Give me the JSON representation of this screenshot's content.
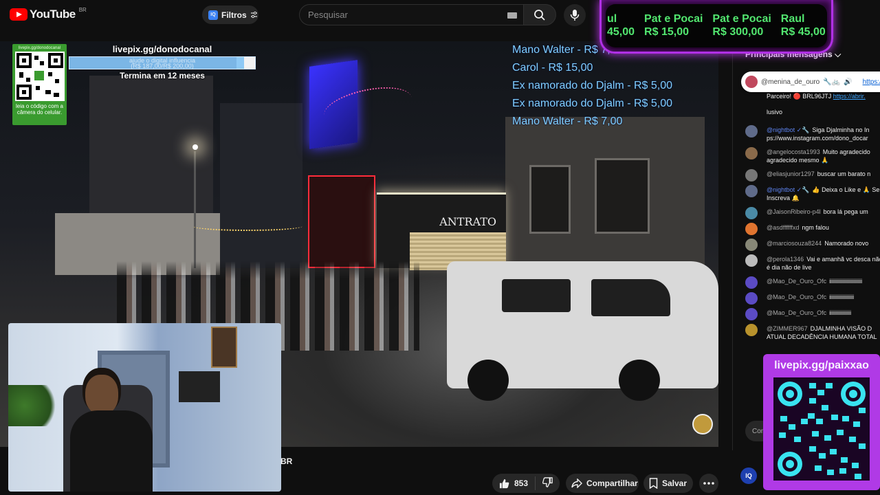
{
  "app": {
    "logo_text": "YouTube",
    "logo_region": "BR"
  },
  "header": {
    "filter_badge": "IQ",
    "filter_label": "Filtros",
    "search_placeholder": "Pesquisar"
  },
  "overlay": {
    "livepix_url": "livepix.gg/donodocanal",
    "goal_line1": "ajude o digital influencia",
    "goal_line2": "(R$ 187,00/R$ 200,00)",
    "goal_progress": 0.9,
    "ends_text": "Termina em 12 meses",
    "qr_top_label": "livepix.gg/donodocanal",
    "qr_caption": "leia o código com a câmera do celular.",
    "donations": [
      "Mano Walter - R$ 7,00",
      "Carol - R$ 15,00",
      "Ex namorado do Djalm - R$ 5,00",
      "Ex namorado do Djalm - R$ 5,00",
      "Mano Walter - R$ 7,00"
    ],
    "shop_name": "ANTRATO"
  },
  "tip_banner": {
    "items": [
      {
        "name": "ul",
        "amount": "45,00"
      },
      {
        "name": "Pat e Pocai",
        "amount": "R$ 15,00"
      },
      {
        "name": "Pat e Pocai",
        "amount": "R$ 300,00"
      },
      {
        "name": "Raul",
        "amount": "R$ 45,00"
      }
    ]
  },
  "video": {
    "channel_suffix": "BR",
    "likes": "853",
    "share_label": "Compartilhar",
    "save_label": "Salvar"
  },
  "chat": {
    "header": "Principais mensagens",
    "pinned_author": "@menina_de_ouro",
    "pinned_link": "https:/",
    "messages": [
      {
        "author": "",
        "text": "Parceiro! 🔴 BRL96JTJ",
        "link": "https://abrir.",
        "color": "#444"
      },
      {
        "author": "",
        "text": "lusivo",
        "color": ""
      },
      {
        "author": "@nightbot ✓🔧",
        "text": "Siga Djalminha no In ps://www.instagram.com/dono_docar",
        "mod": true,
        "color": "#5f6b8a"
      },
      {
        "author": "@angelocosta1993",
        "text": "Muito agradecido agradecido mesmo 🙏",
        "color": "#8a6a4a"
      },
      {
        "author": "@eliasjunior1297",
        "text": "buscar um barato n",
        "color": "#777"
      },
      {
        "author": "@nightbot ✓🔧",
        "text": "👍 Deixa o Like e 🙏 Se Inscreva 🔔",
        "mod": true,
        "color": "#5f6b8a"
      },
      {
        "author": "@JaisonRibeiro-p4l",
        "text": "bora lá pega um",
        "color": "#4a8aa6"
      },
      {
        "author": "@asdffffffxd",
        "text": "ngm falou",
        "color": "#e0742f"
      },
      {
        "author": "@marciosouza8244",
        "text": "Namorado novo",
        "color": "#887"
      },
      {
        "author": "@perola1346",
        "text": "Vai e amanhã vc desca não é dia não de live",
        "color": "#bbb"
      },
      {
        "author": "@Mao_De_Ouro_Ofc",
        "text": "iiiiiiiiiiiiiiiiiiiiiiii",
        "color": "#5b4bc4"
      },
      {
        "author": "@Mao_De_Ouro_Ofc",
        "text": "iiiiiiiiiiiiiiiiii",
        "color": "#5b4bc4"
      },
      {
        "author": "@Mao_De_Ouro_Ofc",
        "text": "iiiiiiiiiiiiiiii",
        "color": "#5b4bc4"
      },
      {
        "author": "@ZIMMER967",
        "text": "DJALMINHA VISÃO D ATUAL DECADÊNCIA HUMANA TOTAL",
        "color": "#b8922c"
      }
    ],
    "input_placeholder": "Con"
  },
  "qr_right": {
    "url": "livepix.gg/paixxao"
  },
  "misc": {
    "iq_label": "IQ"
  },
  "colors": {
    "accent_red": "#ff0000",
    "neon_purple": "#b030e6",
    "tip_green": "#52e66f",
    "donation_blue": "#7fd0ff"
  }
}
